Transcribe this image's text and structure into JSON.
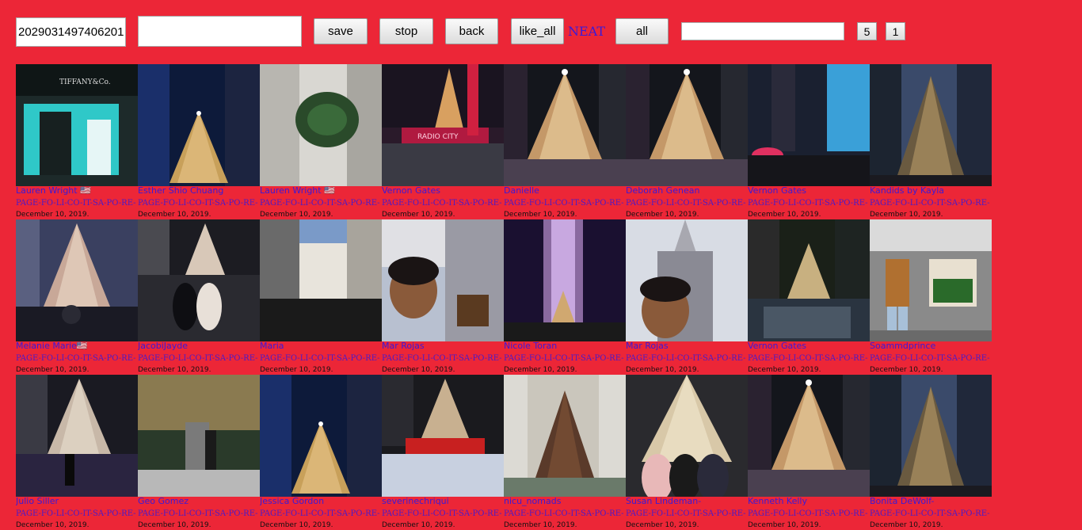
{
  "toolbar": {
    "id_value": "2029031497406201",
    "text_value": "",
    "save_label": "save",
    "stop_label": "stop",
    "back_label": "back",
    "like_all_label": "like_all",
    "neat_label": "NEAT",
    "all_label": "all",
    "small_input_value": "",
    "btn5_label": "5",
    "btn1_label": "1"
  },
  "posts": [
    {
      "author": "Lauren Wright 🇺🇸",
      "tag": "PAGE-FO-LI-CO-IT-SA-PO-RE-",
      "date": "December 10, 2019.",
      "scene": "storefront"
    },
    {
      "author": "Esther Shio Chuang",
      "tag": "PAGE-FO-LI-CO-IT-SA-PO-RE-",
      "date": "December 10, 2019.",
      "scene": "tree-blue-night"
    },
    {
      "author": "Lauren Wright 🇺🇸",
      "tag": "PAGE-FO-LI-CO-IT-SA-PO-RE-",
      "date": "December 10, 2019.",
      "scene": "tree-from-above"
    },
    {
      "author": "Vernon Gates",
      "tag": "PAGE-FO-LI-CO-IT-SA-PO-RE-",
      "date": "December 10, 2019.",
      "scene": "radio-city"
    },
    {
      "author": "Danielle",
      "tag": "PAGE-FO-LI-CO-IT-SA-PO-RE-",
      "date": "December 10, 2019.",
      "scene": "tree-night"
    },
    {
      "author": "Deborah Genean",
      "tag": "PAGE-FO-LI-CO-IT-SA-PO-RE-",
      "date": "December 10, 2019.",
      "scene": "tree-night"
    },
    {
      "author": "Vernon Gates",
      "tag": "PAGE-FO-LI-CO-IT-SA-PO-RE-",
      "date": "December 10, 2019.",
      "scene": "crowd-umbrella"
    },
    {
      "author": "Kandids by Kayla",
      "tag": "PAGE-FO-LI-CO-IT-SA-PO-RE-",
      "date": "December 10, 2019.",
      "scene": "tree-dusk"
    },
    {
      "author": "Melanie Marie🇺🇸",
      "tag": "PAGE-FO-LI-CO-IT-SA-PO-RE-",
      "date": "December 10, 2019.",
      "scene": "tree-crowd"
    },
    {
      "author": "JacobiJayde",
      "tag": "PAGE-FO-LI-CO-IT-SA-PO-RE-",
      "date": "December 10, 2019.",
      "scene": "people-tree"
    },
    {
      "author": "Maria",
      "tag": "PAGE-FO-LI-CO-IT-SA-PO-RE-",
      "date": "December 10, 2019.",
      "scene": "buildings-day"
    },
    {
      "author": "Mar Rojas",
      "tag": "PAGE-FO-LI-CO-IT-SA-PO-RE-",
      "date": "December 10, 2019.",
      "scene": "selfie"
    },
    {
      "author": "Nicole Toran",
      "tag": "PAGE-FO-LI-CO-IT-SA-PO-RE-",
      "date": "December 10, 2019.",
      "scene": "tower-night"
    },
    {
      "author": "Mar Rojas",
      "tag": "PAGE-FO-LI-CO-IT-SA-PO-RE-",
      "date": "December 10, 2019.",
      "scene": "selfie-cathedral"
    },
    {
      "author": "Vernon Gates",
      "tag": "PAGE-FO-LI-CO-IT-SA-PO-RE-",
      "date": "December 10, 2019.",
      "scene": "tree-rain"
    },
    {
      "author": "Soammdprince",
      "tag": "PAGE-FO-LI-CO-IT-SA-PO-RE-",
      "date": "December 10, 2019.",
      "scene": "man-sign"
    },
    {
      "author": "Julio Siller",
      "tag": "PAGE-FO-LI-CO-IT-SA-PO-RE-",
      "date": "December 10, 2019.",
      "scene": "tree-person"
    },
    {
      "author": "Geo Gomez",
      "tag": "PAGE-FO-LI-CO-IT-SA-PO-RE-",
      "date": "December 10, 2019.",
      "scene": "couple-lights"
    },
    {
      "author": "Jessica Gordon",
      "tag": "PAGE-FO-LI-CO-IT-SA-PO-RE-",
      "date": "December 10, 2019.",
      "scene": "tree-blue-night"
    },
    {
      "author": "severinechriqui",
      "tag": "PAGE-FO-LI-CO-IT-SA-PO-RE-",
      "date": "December 10, 2019.",
      "scene": "rink"
    },
    {
      "author": "nicu_nomads",
      "tag": "PAGE-FO-LI-CO-IT-SA-PO-RE-",
      "date": "December 10, 2019.",
      "scene": "tree-day"
    },
    {
      "author": "Susan Lindeman-",
      "tag": "PAGE-FO-LI-CO-IT-SA-PO-RE-",
      "date": "December 10, 2019.",
      "scene": "women-tree"
    },
    {
      "author": "Kenneth Kelly",
      "tag": "PAGE-FO-LI-CO-IT-SA-PO-RE-",
      "date": "December 10, 2019.",
      "scene": "tree-night"
    },
    {
      "author": "Bonita DeWolf-",
      "tag": "PAGE-FO-LI-CO-IT-SA-PO-RE-",
      "date": "December 10, 2019.",
      "scene": "tree-dusk"
    }
  ]
}
